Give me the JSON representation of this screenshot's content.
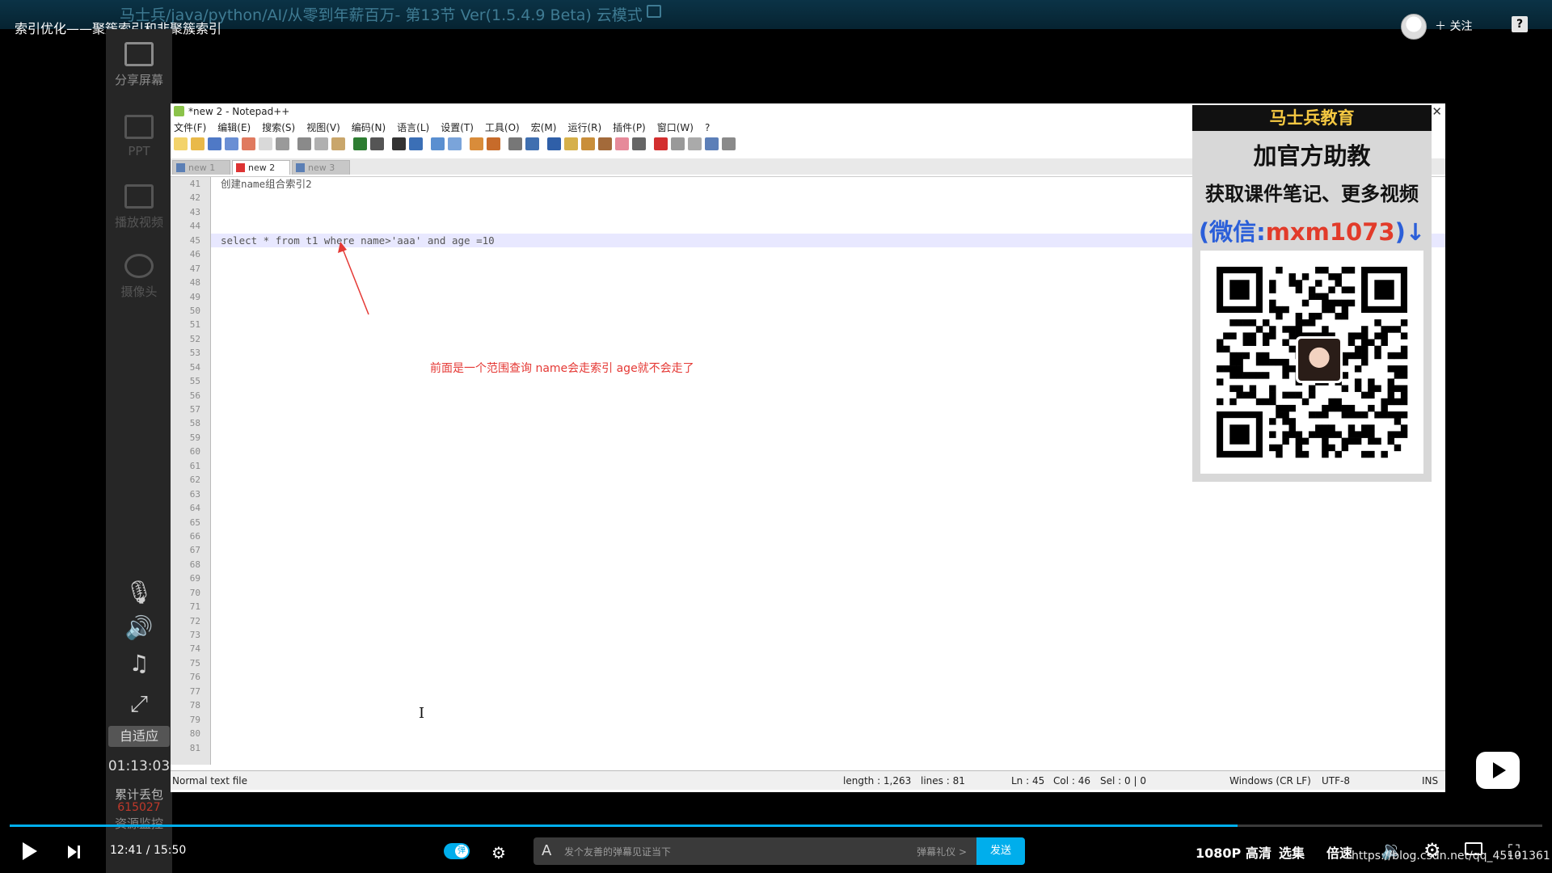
{
  "recorder_title": "马士兵/java/python/AI/从零到年薪百万- 第13节 Ver(1.5.4.9 Beta)  云模式",
  "video_title": "索引优化——聚簇索引和非聚簇索引",
  "follow_label": "关注",
  "help_label": "?",
  "side_panel": {
    "items": [
      {
        "label": "分享屏幕",
        "active": true
      },
      {
        "label": "PPT",
        "active": false
      },
      {
        "label": "播放视频",
        "active": false
      },
      {
        "label": "摄像头",
        "active": false
      }
    ],
    "fit_label": "自适应",
    "timer": "01:13:03",
    "stat_label": "累计丢包",
    "stat_value": "615027",
    "monitor_label": "资源监控"
  },
  "notepad": {
    "title": "*new 2 - Notepad++",
    "menu": [
      "文件(F)",
      "编辑(E)",
      "搜索(S)",
      "视图(V)",
      "编码(N)",
      "语言(L)",
      "设置(T)",
      "工具(O)",
      "宏(M)",
      "运行(R)",
      "插件(P)",
      "窗口(W)",
      "?"
    ],
    "tabs": [
      {
        "label": "new 1",
        "active": false
      },
      {
        "label": "new 2",
        "active": true
      },
      {
        "label": "new 3",
        "active": false
      }
    ],
    "line_start": 41,
    "line_end": 81,
    "current_line": 45,
    "lines": {
      "41": "创建name组合索引2",
      "45": "select * from t1 where name>'aaa' and age =10"
    },
    "annotation": "前面是一个范围查询  name会走索引  age就不会走了",
    "annotation_color": "#e53935",
    "status": {
      "file_type": "Normal text file",
      "length": "length : 1,263",
      "lines": "lines : 81",
      "ln": "Ln : 45",
      "col": "Col : 46",
      "sel": "Sel : 0 | 0",
      "eol": "Windows (CR LF)",
      "encoding": "UTF-8",
      "mode": "INS"
    }
  },
  "promo": {
    "header": "马士兵教育",
    "line1": "加官方助教",
    "line2": "获取课件笔记、更多视频",
    "wechat_prefix": "(微信:",
    "wechat_id": "mxm1073",
    "wechat_suffix": ")↓",
    "header_color": "#f5c842",
    "accent_color": "#2b5fd9",
    "id_color": "#e23b2a"
  },
  "player": {
    "current_time": "12:41",
    "total_time": "15:50",
    "progress": 0.801,
    "danmaku_placeholder": "发个友善的弹幕见证当下",
    "danmaku_rules": "弹幕礼仪 >",
    "send_label": "发送",
    "quality": "1080P 高清",
    "episodes": "选集",
    "speed": "倍速",
    "accent_color": "#00aeec"
  },
  "watermark": "https://blog.csdn.net/qq_45101361"
}
